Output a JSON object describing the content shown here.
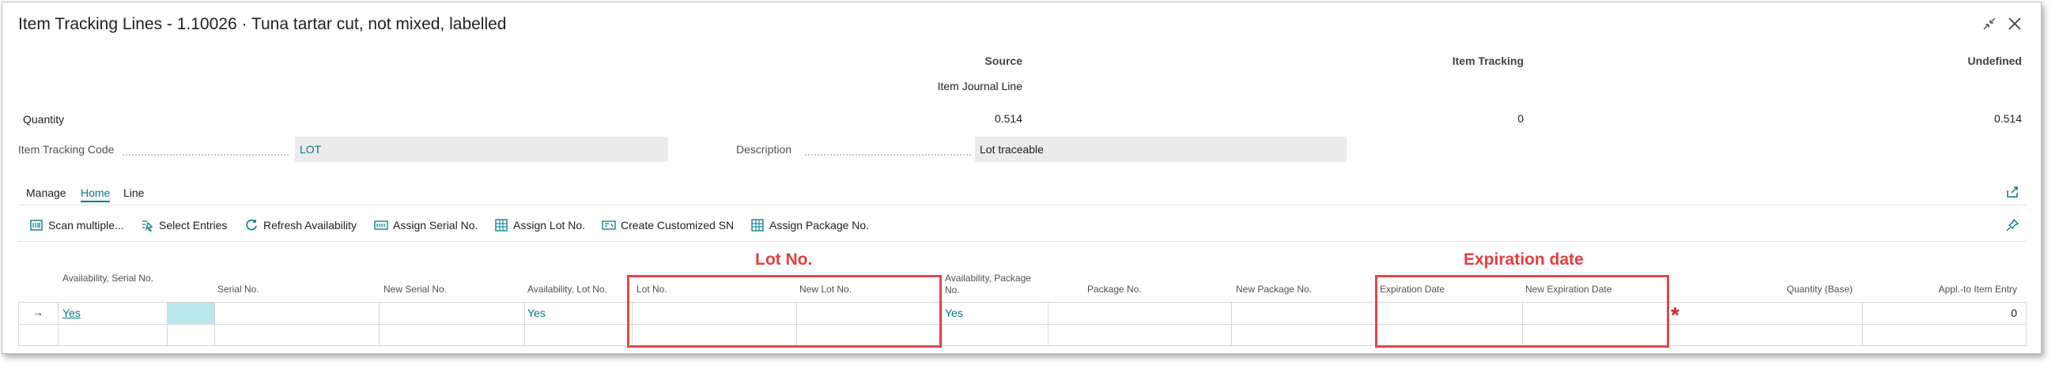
{
  "dialog": {
    "title": "Item Tracking Lines - 1.10026 · Tuna tartar cut, not mixed, labelled"
  },
  "summary": {
    "col_source": "Source",
    "col_item_tracking": "Item Tracking",
    "col_undefined": "Undefined",
    "source_name": "Item Journal Line",
    "quantity_label": "Quantity",
    "quantity_source": "0.514",
    "quantity_item_tracking": "0",
    "quantity_undefined": "0.514"
  },
  "fields": {
    "item_tracking_code_label": "Item Tracking Code",
    "item_tracking_code_value": "LOT",
    "description_label": "Description",
    "description_value": "Lot traceable"
  },
  "menu": {
    "manage": "Manage",
    "home": "Home",
    "line": "Line"
  },
  "actions": {
    "scan_multiple": "Scan multiple...",
    "select_entries": "Select Entries",
    "refresh_availability": "Refresh Availability",
    "assign_serial": "Assign Serial No.",
    "assign_lot": "Assign Lot No.",
    "create_customized_sn": "Create Customized SN",
    "assign_package": "Assign Package No."
  },
  "grid": {
    "headers": {
      "availability_serial": "Availability, Serial No.",
      "serial_no": "Serial No.",
      "new_serial_no": "New Serial No.",
      "availability_lot": "Availability, Lot No.",
      "lot_no": "Lot No.",
      "new_lot_no": "New Lot No.",
      "availability_package": "Availability, Package No.",
      "package_no": "Package No.",
      "new_package_no": "New Package No.",
      "expiration_date": "Expiration Date",
      "new_expiration_date": "New Expiration Date",
      "quantity_base": "Quantity (Base)",
      "appl_to_item_entry": "Appl.-to Item Entry"
    },
    "row1": {
      "arrow": "→",
      "availability_serial": "Yes",
      "availability_lot": "Yes",
      "availability_package": "Yes",
      "appl_to_item_entry": "0"
    }
  },
  "annotations": {
    "lot_label": "Lot No.",
    "expiration_label": "Expiration date",
    "asterisk": "*"
  },
  "colors": {
    "accent": "#00788c",
    "annotation": "#e53e3e",
    "selected_cell": "#b9e9ef"
  }
}
